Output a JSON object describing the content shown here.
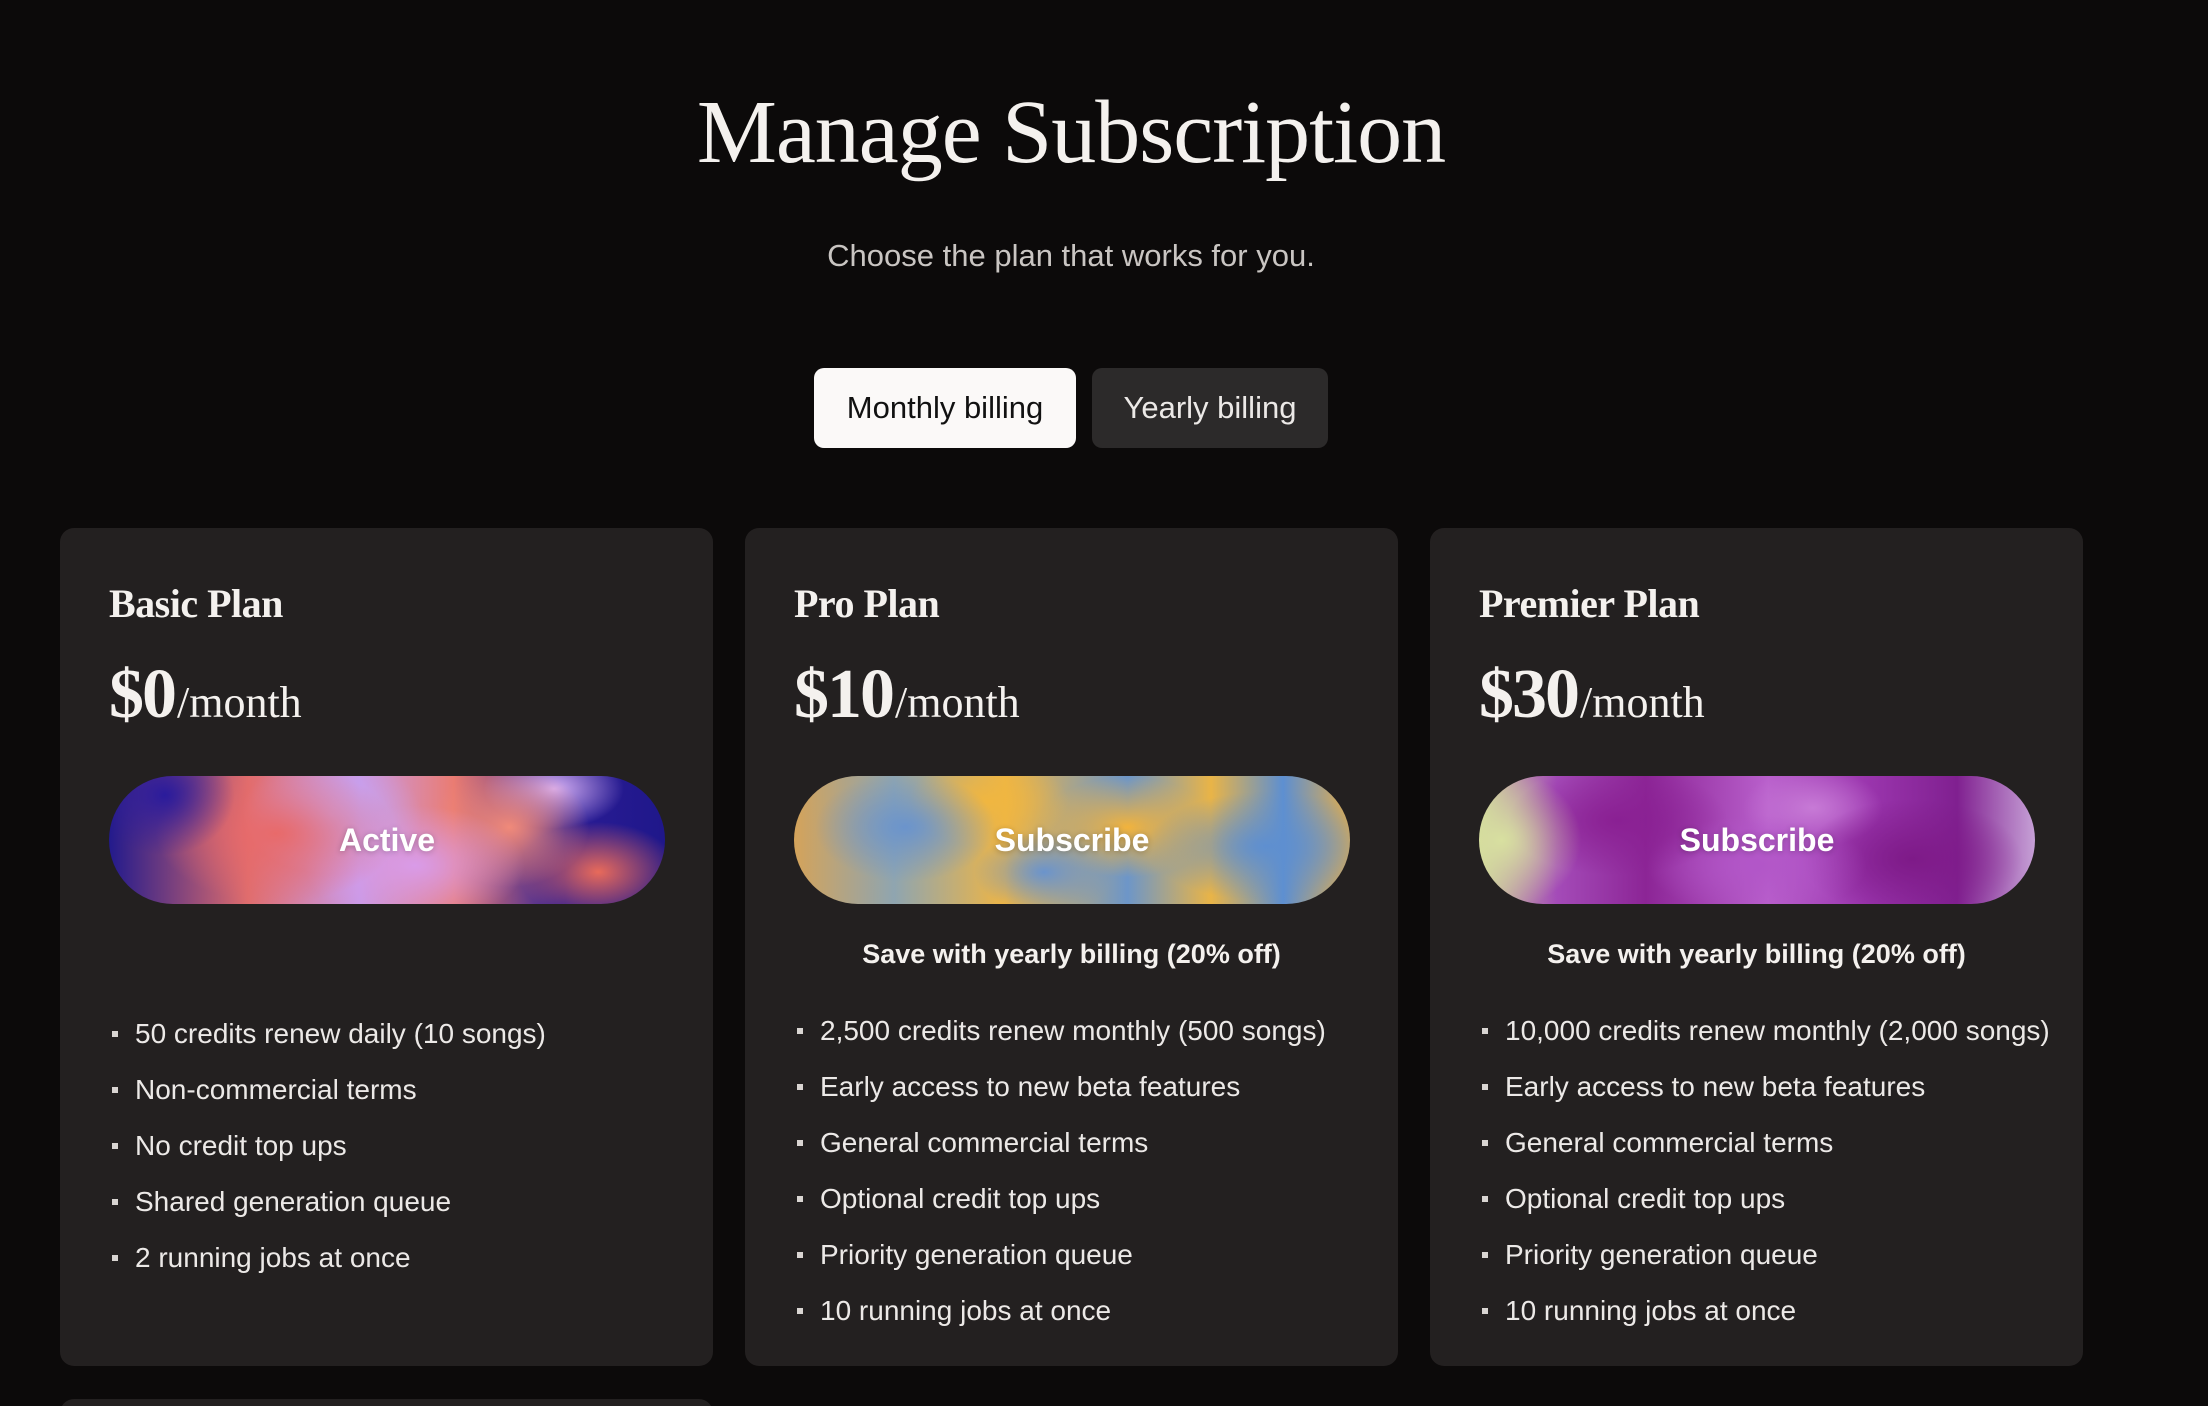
{
  "header": {
    "title": "Manage Subscription",
    "subtitle": "Choose the plan that works for you."
  },
  "billing_toggle": {
    "monthly_label": "Monthly billing",
    "yearly_label": "Yearly billing",
    "selected": "Monthly billing"
  },
  "plans": [
    {
      "name": "Basic Plan",
      "price": "$0",
      "period": "/month",
      "action_label": "Active",
      "note": "",
      "features": [
        "50 credits renew daily (10 songs)",
        "Non-commercial terms",
        "No credit top ups",
        "Shared generation queue",
        "2 running jobs at once"
      ]
    },
    {
      "name": "Pro Plan",
      "price": "$10",
      "period": "/month",
      "action_label": "Subscribe",
      "note": "Save with yearly billing (20% off)",
      "features": [
        "2,500 credits renew monthly (500 songs)",
        "Early access to new beta features",
        "General commercial terms",
        "Optional credit top ups",
        "Priority generation queue",
        "10 running jobs at once"
      ]
    },
    {
      "name": "Premier Plan",
      "price": "$30",
      "period": "/month",
      "action_label": "Subscribe",
      "note": "Save with yearly billing (20% off)",
      "features": [
        "10,000 credits renew monthly (2,000 songs)",
        "Early access to new beta features",
        "General commercial terms",
        "Optional credit top ups",
        "Priority generation queue",
        "10 running jobs at once"
      ]
    }
  ],
  "colors": {
    "background": "#0c0a0a",
    "card": "#232020",
    "toggle_active": "#fbf9f8",
    "toggle_inactive": "#2c2a2a"
  }
}
